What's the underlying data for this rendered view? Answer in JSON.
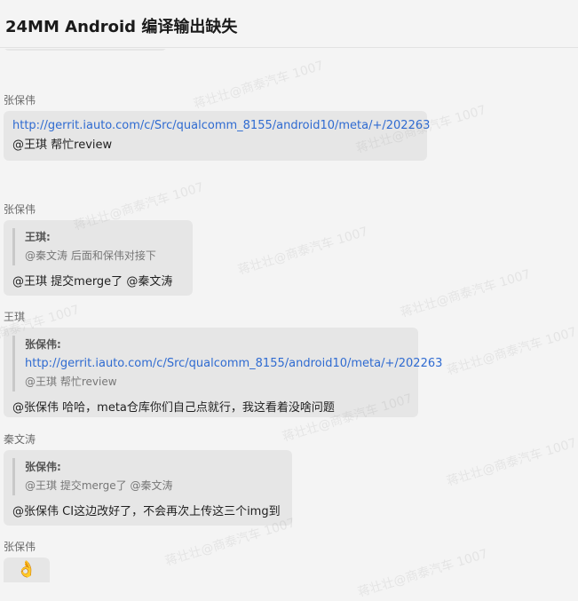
{
  "header": {
    "title": "24MM Android 编译输出缺失"
  },
  "messages": [
    {
      "sender": "张保伟",
      "link": "http://gerrit.iauto.com/c/Src/qualcomm_8155/android10/meta/+/202263",
      "mention": "@王琪",
      "text": "帮忙review"
    },
    {
      "sender": "张保伟",
      "quote": {
        "name": "王琪:",
        "mention": "@秦文涛",
        "text": "后面和保伟对接下"
      },
      "mention": "@王琪",
      "text": "提交merge了",
      "mention2": "@秦文涛"
    },
    {
      "sender": "王琪",
      "quote": {
        "name": "张保伟:",
        "link": "http://gerrit.iauto.com/c/Src/qualcomm_8155/android10/meta/+/202263",
        "mention": "@王琪",
        "text": "帮忙review"
      },
      "mention": "@张保伟",
      "text": "哈哈，meta仓库你们自己点就行，我这看着没啥问题"
    },
    {
      "sender": "秦文涛",
      "quote": {
        "name": "张保伟:",
        "mention": "@王琪",
        "text": "提交merge了",
        "mention2": "@秦文涛"
      },
      "mention": "@张保伟",
      "text": "CI这边改好了，不会再次上传这三个img到"
    },
    {
      "sender": "张保伟",
      "emoji": "👌"
    }
  ],
  "watermark": "蒋壮壮@商泰汽车 1007"
}
